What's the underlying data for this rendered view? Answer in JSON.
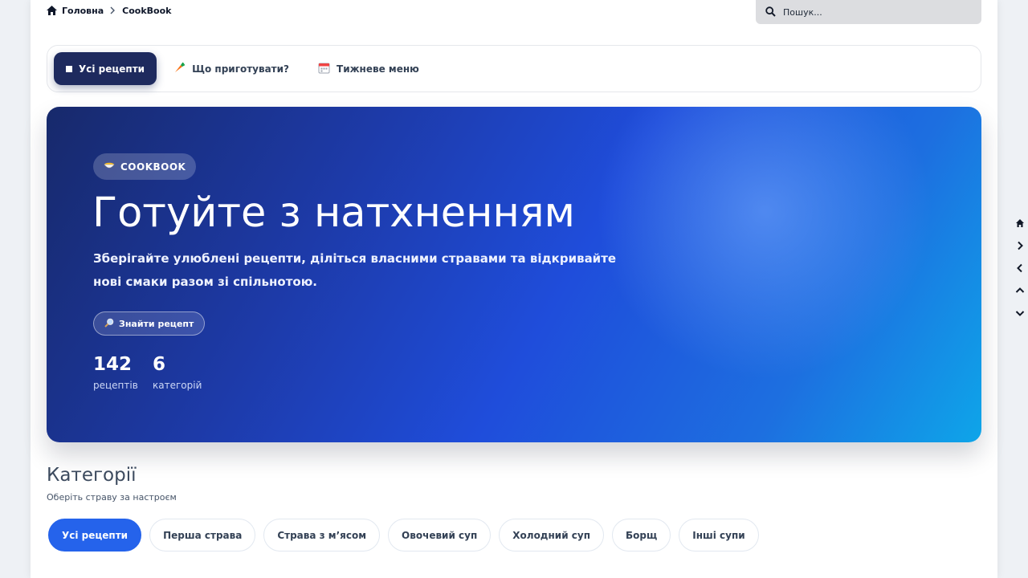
{
  "breadcrumb": {
    "home": "Головна",
    "current": "CookBook"
  },
  "search": {
    "placeholder": "Пошук..."
  },
  "tabs": [
    {
      "label": "Усі рецепти",
      "icon": "square-icon",
      "active": true
    },
    {
      "label": "Що приготувати?",
      "icon": "carrot-icon",
      "active": false
    },
    {
      "label": "Тижневе меню",
      "icon": "calendar-icon",
      "active": false
    }
  ],
  "hero": {
    "badge": "COOKBOOK",
    "title": "Готуйте з натхненням",
    "subtitle": "Зберігайте улюблені рецепти, діліться власними стравами та відкривайте нові смаки разом зі спільнотою.",
    "button": "Знайти рецепт",
    "stats": [
      {
        "value": "142",
        "label": "рецептів"
      },
      {
        "value": "6",
        "label": "категорій"
      }
    ]
  },
  "categories": {
    "title": "Категорії",
    "subtitle": "Оберіть страву за настроєм",
    "chips": [
      "Усі рецепти",
      "Перша страва",
      "Страва з м’ясом",
      "Овочевий суп",
      "Холодний суп",
      "Борщ",
      "Інші супи"
    ],
    "active_index": 0
  },
  "sidenav": [
    "home-icon",
    "chevron-right-icon",
    "chevron-left-icon",
    "chevron-up-icon",
    "chevron-down-icon"
  ],
  "colors": {
    "accent": "#2563eb",
    "active_tab": "#1e2a5e",
    "hero_start": "#17296b",
    "hero_end": "#0ea5e9"
  }
}
